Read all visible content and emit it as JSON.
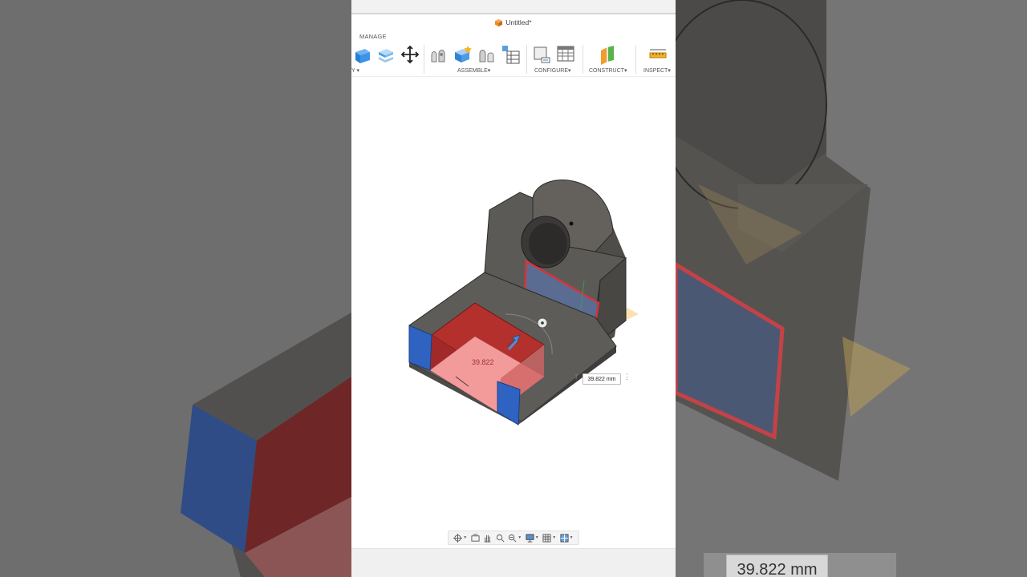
{
  "window": {
    "title": "Untitled*"
  },
  "toolbar": {
    "tab_label": "MANAGE",
    "groups": [
      {
        "label": "Y",
        "caret": "▾"
      },
      {
        "label": "ASSEMBLE",
        "caret": "▾"
      },
      {
        "label": "CONFIGURE",
        "caret": "▾"
      },
      {
        "label": "CONSTRUCT",
        "caret": "▾"
      },
      {
        "label": "INSPECT",
        "caret": "▾"
      }
    ]
  },
  "viewport": {
    "dimension_label": "39.822",
    "dimension_input_value": "39.822 mm",
    "dimension_menu": "⋮"
  },
  "background": {
    "dimension_value": "39.822 mm"
  },
  "colors": {
    "accent_orange": "#f08a24",
    "face_red": "#c0302f",
    "face_pink": "#f4a0a0",
    "face_blue": "#2e63c2",
    "body_gray": "#5f5d58",
    "edge_highlight": "#e0323a"
  },
  "icons": {
    "document": "orange-cube-icon",
    "nav": [
      "orbit-icon",
      "look-at-icon",
      "pan-icon",
      "zoom-icon",
      "display-settings-icon",
      "grid-settings-icon",
      "viewports-icon"
    ]
  }
}
